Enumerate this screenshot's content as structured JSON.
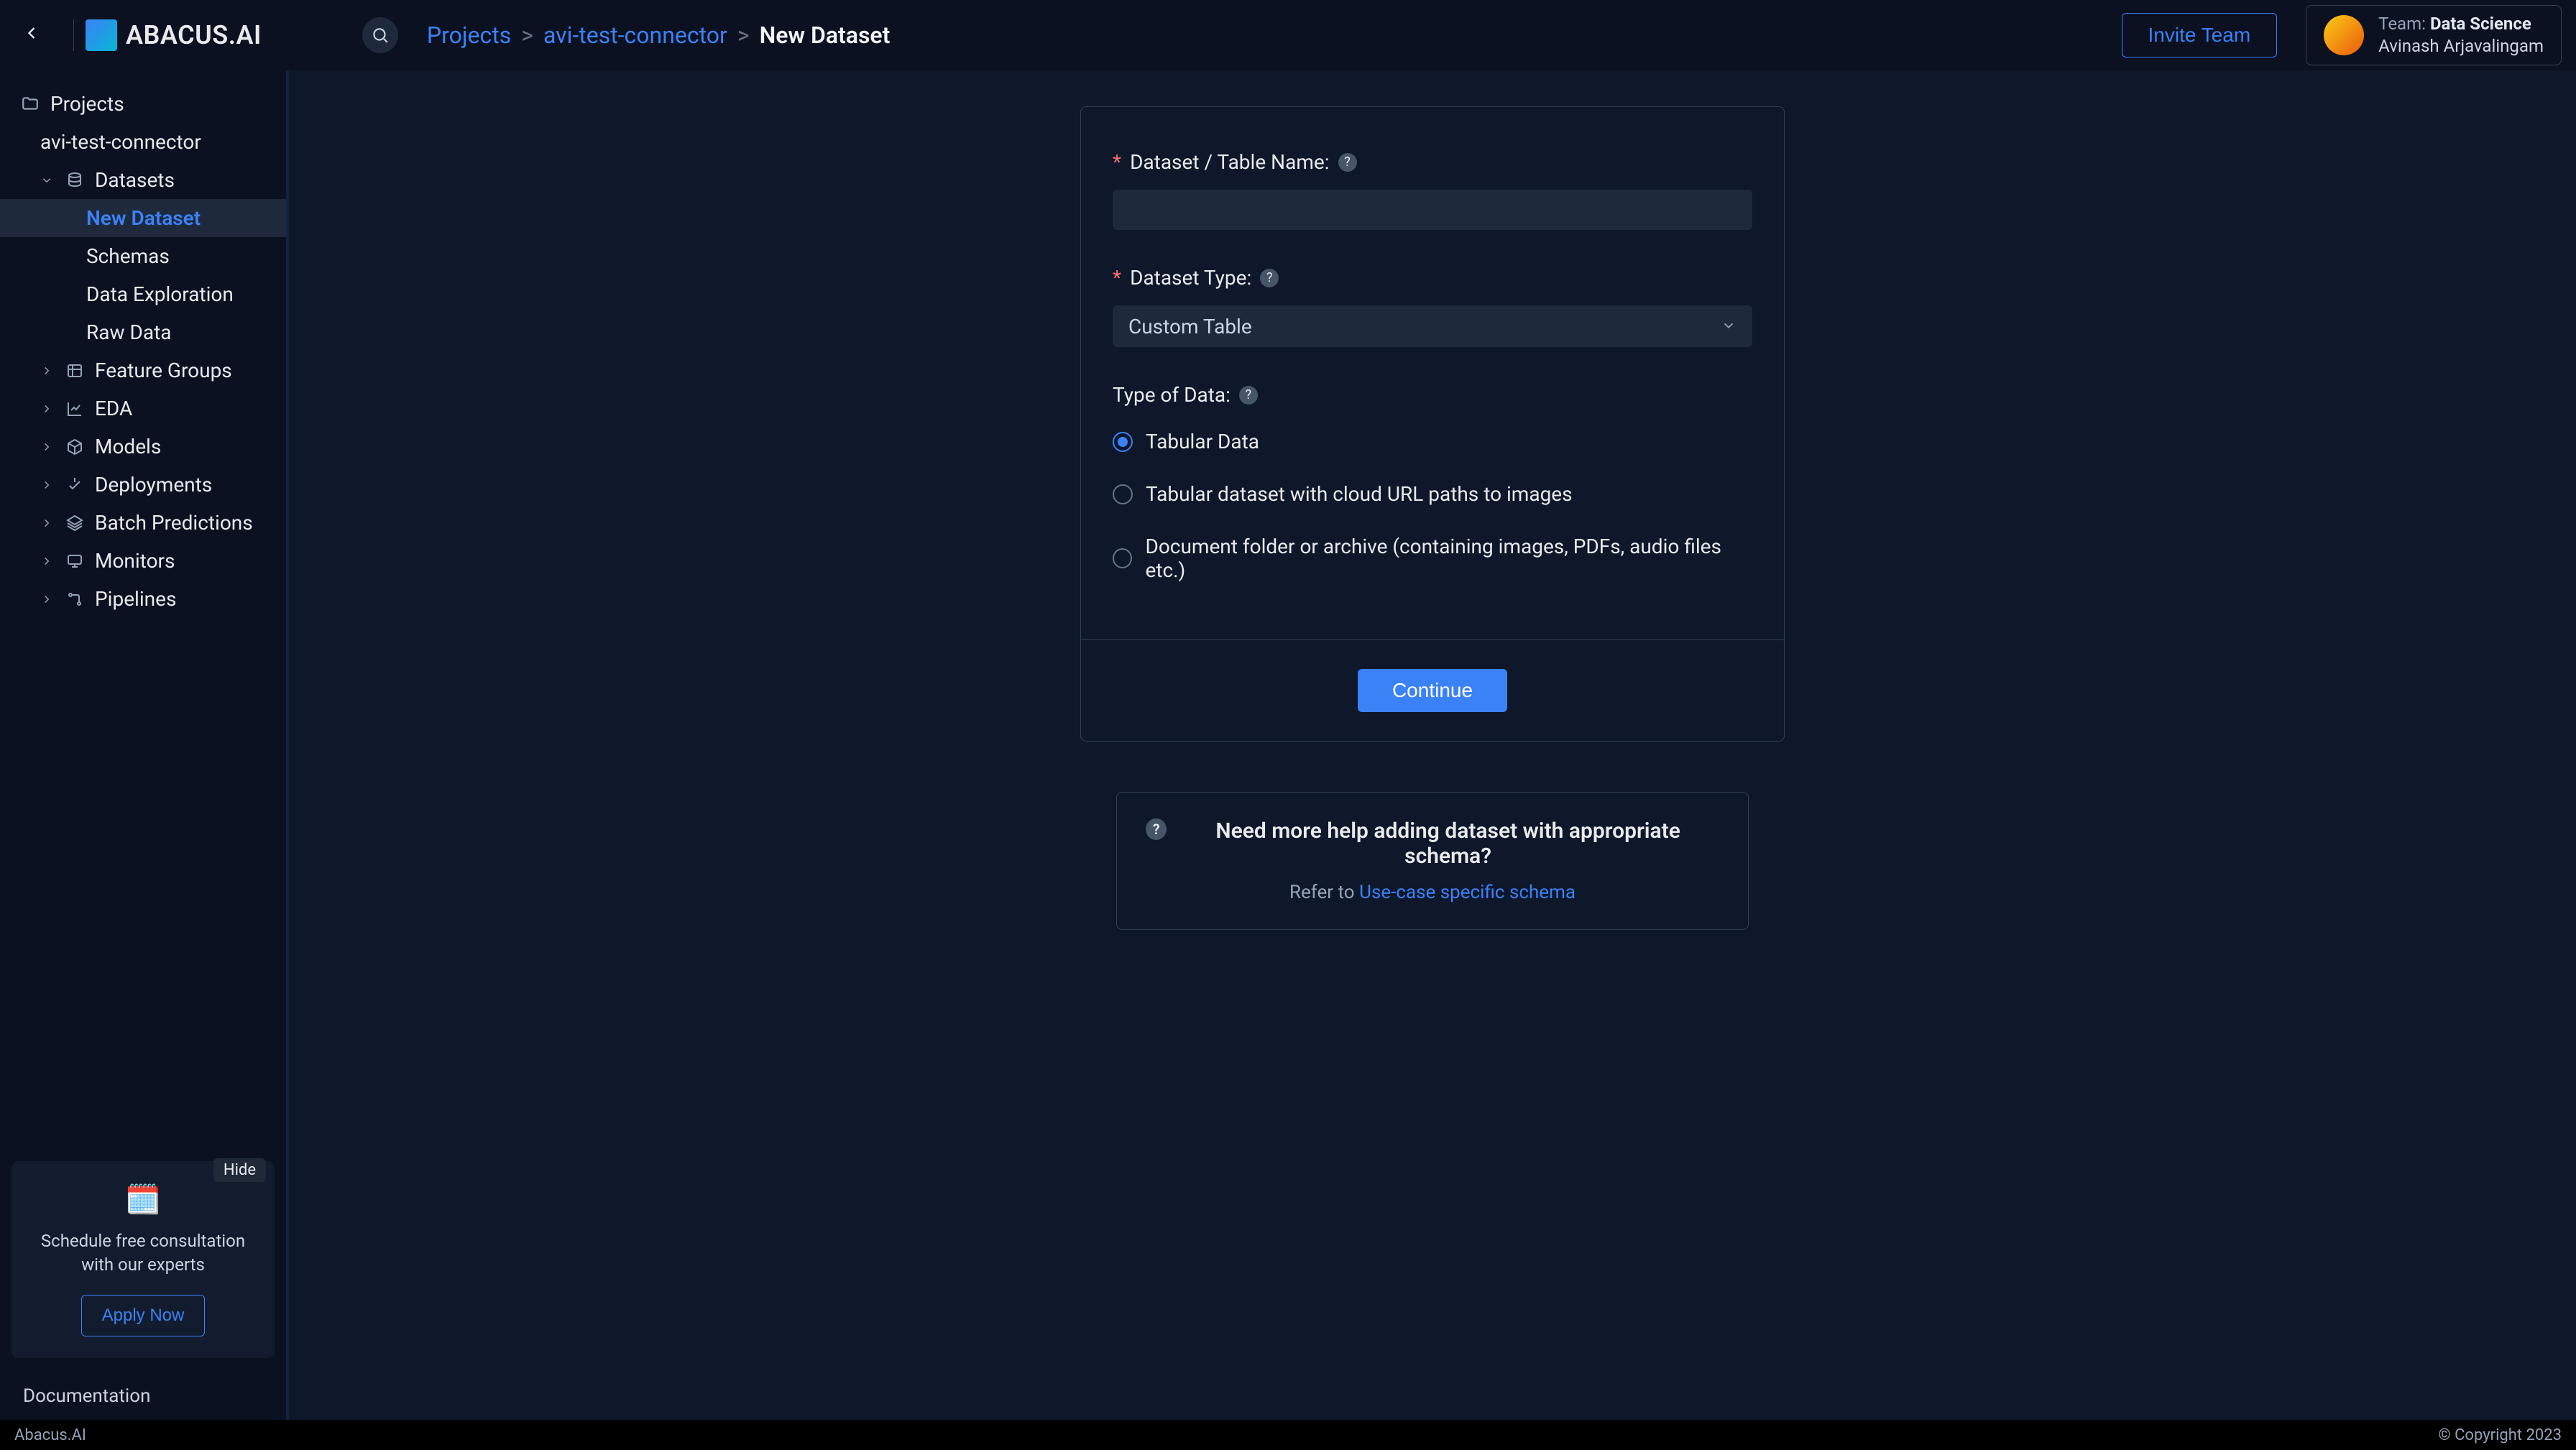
{
  "header": {
    "logo_text": "ABACUS.AI",
    "breadcrumb": {
      "projects": "Projects",
      "project": "avi-test-connector",
      "current": "New Dataset"
    },
    "invite_label": "Invite Team",
    "team": {
      "prefix": "Team: ",
      "name": "Data Science",
      "user": "Avinash Arjavalingam"
    }
  },
  "sidebar": {
    "projects": "Projects",
    "project": "avi-test-connector",
    "datasets": "Datasets",
    "new_dataset": "New Dataset",
    "schemas": "Schemas",
    "data_exploration": "Data Exploration",
    "raw_data": "Raw Data",
    "feature_groups": "Feature Groups",
    "eda": "EDA",
    "models": "Models",
    "deployments": "Deployments",
    "batch_predictions": "Batch Predictions",
    "monitors": "Monitors",
    "pipelines": "Pipelines",
    "promo": {
      "hide": "Hide",
      "text": "Schedule free consultation with our experts",
      "cta": "Apply Now"
    },
    "documentation": "Documentation"
  },
  "form": {
    "name_label": "Dataset / Table Name:",
    "name_value": "",
    "type_label": "Dataset Type:",
    "type_value": "Custom Table",
    "kind_label": "Type of Data:",
    "radio_tabular": "Tabular Data",
    "radio_cloud": "Tabular dataset with cloud URL paths to images",
    "radio_document": "Document folder or archive (containing images, PDFs, audio files etc.)",
    "continue": "Continue"
  },
  "callout": {
    "title": "Need more help adding dataset with appropriate schema?",
    "refer": "Refer to ",
    "link": "Use-case specific schema"
  },
  "footer": {
    "brand": "Abacus.AI",
    "copy": "© Copyright 2023"
  }
}
